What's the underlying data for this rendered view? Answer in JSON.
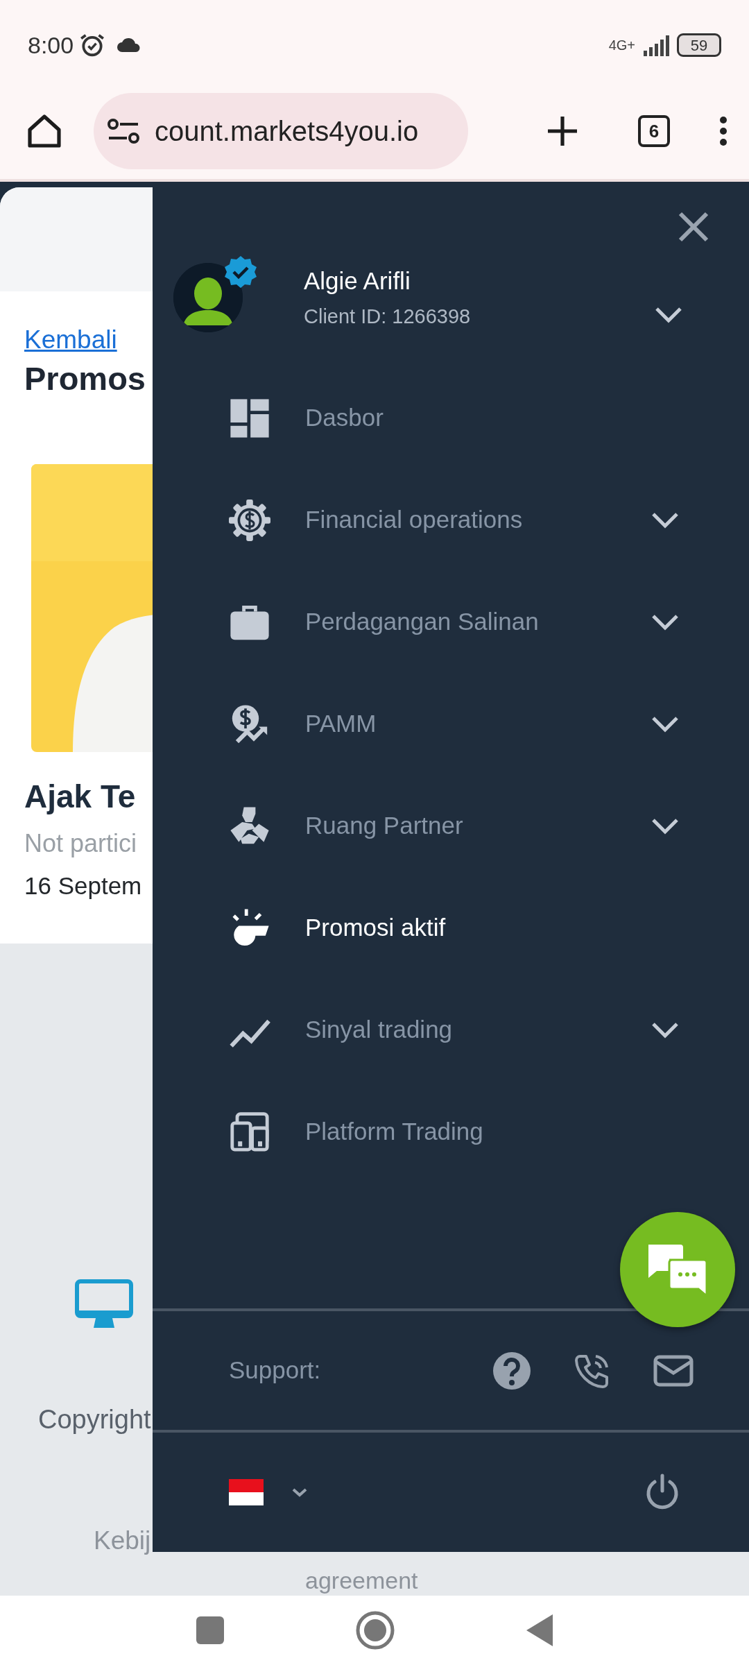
{
  "status_bar": {
    "time": "8:00",
    "network": "4G+",
    "battery": "59"
  },
  "browser": {
    "url": "count.markets4you.io",
    "tab_count": "6"
  },
  "page": {
    "back_link": "Kembali",
    "title": "Promos",
    "promo": {
      "kind": "picture",
      "title": "Ajak Te",
      "status": "Not partici",
      "date": "16 Septem"
    },
    "footer": {
      "copyright": "Copyright",
      "link": "Kebij",
      "agreement": "agreement"
    }
  },
  "drawer": {
    "user": {
      "name": "Algie Arifli",
      "client_id": "Client ID: 1266398",
      "verified": true
    },
    "menu": [
      {
        "label": "Dasbor",
        "selected": false,
        "expandable": false
      },
      {
        "label": "Financial operations",
        "selected": false,
        "expandable": true
      },
      {
        "label": "Perdagangan Salinan",
        "selected": false,
        "expandable": true
      },
      {
        "label": "PAMM",
        "selected": false,
        "expandable": true
      },
      {
        "label": "Ruang Partner",
        "selected": false,
        "expandable": true
      },
      {
        "label": "Promosi aktif",
        "selected": true,
        "expandable": false
      },
      {
        "label": "Sinyal trading",
        "selected": false,
        "expandable": true
      },
      {
        "label": "Platform Trading",
        "selected": false,
        "expandable": false
      }
    ],
    "support": {
      "label": "Support:"
    }
  }
}
